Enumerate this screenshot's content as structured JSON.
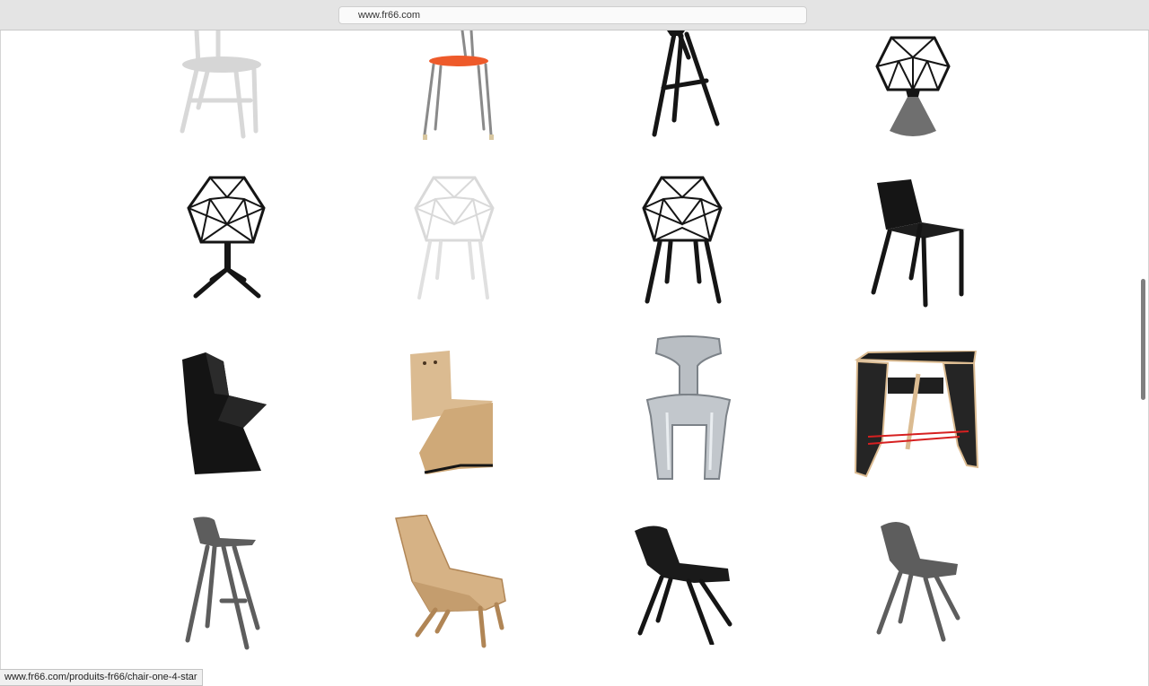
{
  "browser": {
    "url": "www.fr66.com"
  },
  "status": {
    "hover_link": "www.fr66.com/produits-fr66/chair-one-4-star"
  },
  "grid": {
    "rows": [
      [
        "white-metal-chair-icon",
        "orange-stool-icon",
        "black-tripod-stool-icon",
        "chair-one-concrete-icon"
      ],
      [
        "chair-one-4-star-icon",
        "chair-one-white-icon",
        "chair-one-black-icon",
        "black-plastic-chair-icon"
      ],
      [
        "black-faceted-chair-icon",
        "plywood-chair-icon",
        "aluminium-chair-icon",
        "wooden-stool-table-icon"
      ],
      [
        "grey-bar-stool-icon",
        "oak-lounge-chair-icon",
        "black-dining-chair-icon",
        "grey-dining-chair-icon"
      ]
    ]
  },
  "colors": {
    "seat_orange": "#ee5a2a",
    "metal_black": "#151515",
    "metal_white": "#e8e8e8",
    "aluminium": "#b9bec3",
    "wood_light": "#dbbb91",
    "concrete_grey": "#6f6f6f",
    "stone_grey": "#5d5d5d",
    "accent_red": "#d62020"
  }
}
